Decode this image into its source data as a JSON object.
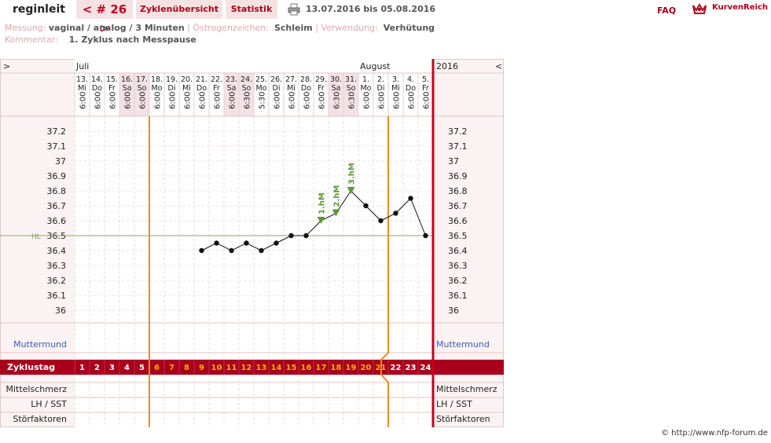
{
  "header": {
    "user": "reginleit",
    "cycle_nav": "< # 26 >",
    "tab_overview": "Zyklenübersicht",
    "tab_stats": "Statistik",
    "date_range": "13.07.2016 bis 05.08.2016",
    "faq": "FAQ",
    "brand": "KurvenReich"
  },
  "meta": {
    "messung_label": "Messung:",
    "messung_value": "vaginal / analog / 3 Minuten",
    "oestrogen_label": "Östrogenzeichen:",
    "oestrogen_value": "Schleim",
    "verwendung_label": "Verwendung:",
    "verwendung_value": "Verhütung",
    "kommentar_label": "Kommentar:",
    "kommentar_value": "1. Zyklus nach Messpause"
  },
  "colors": {
    "accent": "#a8001c",
    "orange_line": "#f28a1e",
    "red_line": "#c8001e",
    "hl_line": "#8aa86a",
    "marker": "#5a9a3a",
    "cycle_day_fertile": "#f6b000"
  },
  "chart_data": {
    "type": "line",
    "nav_left": ">",
    "nav_right": "<",
    "year": "2016",
    "months": [
      {
        "label": "Juli",
        "day_index": 0
      },
      {
        "label": "August",
        "day_index": 19
      }
    ],
    "dates": [
      "13.",
      "14.",
      "15.",
      "16.",
      "17.",
      "18.",
      "19.",
      "20.",
      "21.",
      "22.",
      "23.",
      "24.",
      "25.",
      "26.",
      "27.",
      "28.",
      "29.",
      "30.",
      "31.",
      "1.",
      "2.",
      "3.",
      "4.",
      "5."
    ],
    "weekdays": [
      "Mi",
      "Do",
      "Fr",
      "Sa",
      "So",
      "Mo",
      "Di",
      "Mi",
      "Do",
      "Fr",
      "Sa",
      "So",
      "Mo",
      "Di",
      "Mi",
      "Do",
      "Fr",
      "Sa",
      "So",
      "Mo",
      "Di",
      "Mi",
      "Do",
      "Fr"
    ],
    "weekend_indices": [
      3,
      4,
      10,
      11,
      17,
      18
    ],
    "times": [
      "6:00",
      "6:00",
      "6:00",
      "6:00",
      "6:00",
      "6:00",
      "6:00",
      "6:00",
      "6:00",
      "6:00",
      "6:00",
      "6:30",
      "5:30",
      "6:00",
      "6:00",
      "6:00",
      "6:00",
      "6:30",
      "6:30",
      "6:00",
      "6:00",
      "6:00",
      "6:00",
      "6:00"
    ],
    "cycle_days": [
      "1",
      "2",
      "3",
      "4",
      "5",
      "6",
      "7",
      "8",
      "9",
      "10",
      "11",
      "12",
      "13",
      "14",
      "15",
      "16",
      "17",
      "18",
      "19",
      "20",
      "21",
      "22",
      "23",
      "24"
    ],
    "fertile_from_index": 5,
    "fertile_to_index": 20,
    "y_ticks": [
      37.2,
      37.1,
      37,
      36.9,
      36.8,
      36.7,
      36.6,
      36.5,
      36.4,
      36.3,
      36.2,
      36.1,
      36
    ],
    "ylim": [
      36,
      37.2
    ],
    "hl_label": "HL",
    "hl_value": 36.5,
    "temperatures": [
      null,
      null,
      null,
      null,
      null,
      null,
      null,
      null,
      36.4,
      36.45,
      36.4,
      36.45,
      36.4,
      36.45,
      36.5,
      36.5,
      36.6,
      36.65,
      36.8,
      36.7,
      36.6,
      36.65,
      36.75,
      36.5
    ],
    "high_markers": [
      {
        "index": 16,
        "label": "1.hM"
      },
      {
        "index": 17,
        "label": "2.hM"
      },
      {
        "index": 18,
        "label": "3.hM"
      }
    ],
    "vertical_lines": [
      {
        "after_index": 4
      },
      {
        "after_index": 20
      }
    ],
    "rows": {
      "muttermund": "Muttermund",
      "zyklustag": "Zyklustag",
      "mittelschmerz": "Mittelschmerz",
      "lh": "LH / SST",
      "stoerfaktoren": "Störfaktoren"
    }
  },
  "footer": {
    "copyright": "© http://www.nfp-forum.de"
  }
}
